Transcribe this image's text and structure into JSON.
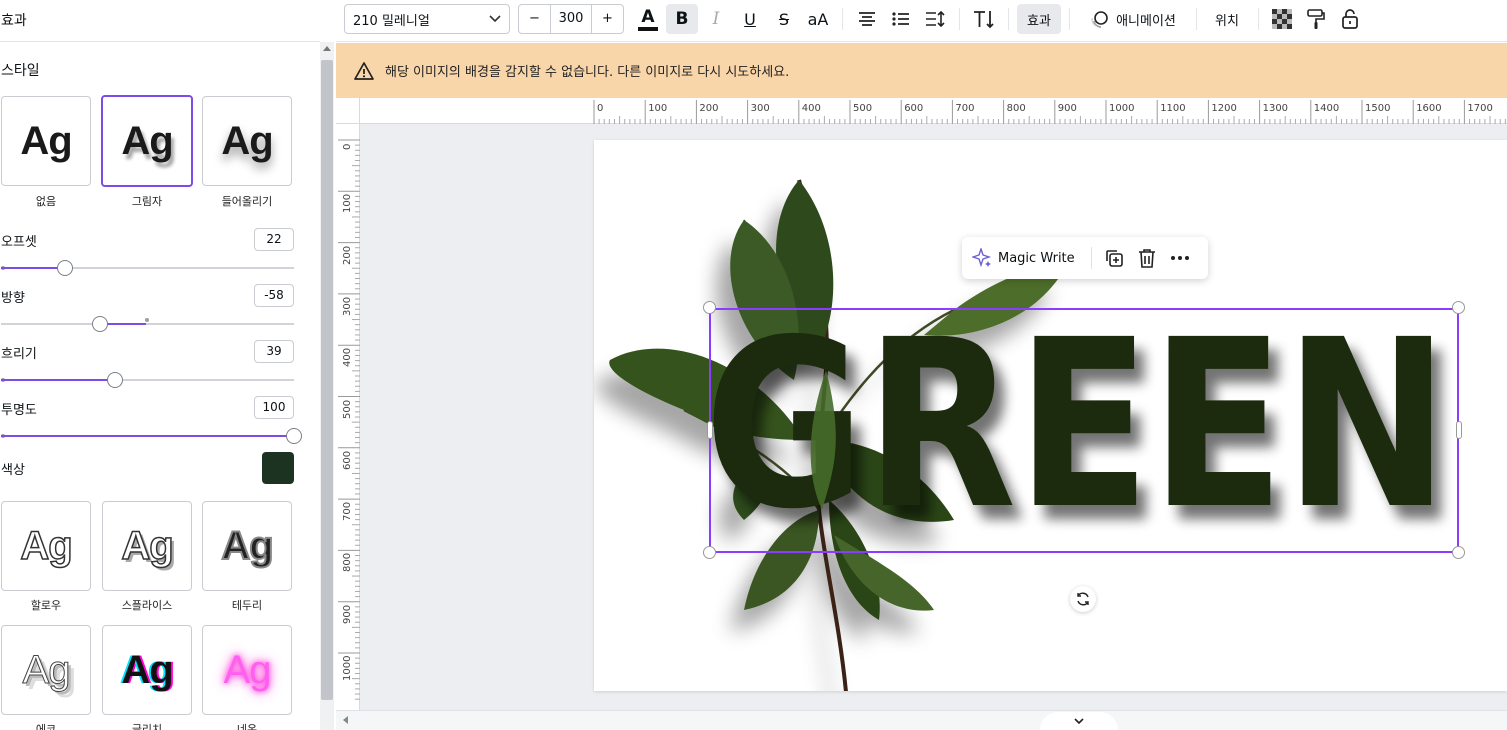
{
  "panel": {
    "title": "효과",
    "style_section": "스타일",
    "style_tiles": [
      {
        "label": "없음",
        "sample": "Ag"
      },
      {
        "label": "그림자",
        "sample": "Ag"
      },
      {
        "label": "들어올리기",
        "sample": "Ag"
      }
    ],
    "controls": [
      {
        "label": "오프셋",
        "value": "22"
      },
      {
        "label": "방향",
        "value": "-58"
      },
      {
        "label": "흐리기",
        "value": "39"
      },
      {
        "label": "투명도",
        "value": "100"
      }
    ],
    "color_label": "색상",
    "shadow_color": "#1b3320",
    "effect_tiles": [
      {
        "label": "할로우",
        "sample": "Ag"
      },
      {
        "label": "스플라이스",
        "sample": "Ag"
      },
      {
        "label": "테두리",
        "sample": "Ag"
      },
      {
        "label": "에코",
        "sample": "Ag"
      },
      {
        "label": "글리치",
        "sample": "Ag"
      },
      {
        "label": "네온",
        "sample": "Ag"
      }
    ]
  },
  "toolbar": {
    "font_name": "210 밀레니얼",
    "font_size": "300",
    "minus": "−",
    "plus": "+",
    "text_color_label": "A",
    "bold": "B",
    "italic": "I",
    "underline": "U",
    "strike": "S",
    "case": "aA",
    "effects": "효과",
    "animate": "애니메이션",
    "position": "위치",
    "accent": "#7d4be8"
  },
  "warning": {
    "text": "해당 이미지의 배경을 감지할 수 없습니다. 다른 이미지로 다시 시도하세요."
  },
  "ruler": {
    "top": [
      "0",
      "100",
      "200",
      "300",
      "400",
      "500",
      "600",
      "700",
      "800",
      "900",
      "1000",
      "1100",
      "1200",
      "1300",
      "1400",
      "1500",
      "1600",
      "1700"
    ],
    "left": [
      "0",
      "100",
      "200",
      "300",
      "400",
      "500",
      "600",
      "700",
      "800",
      "900",
      "1000"
    ]
  },
  "canvas": {
    "text": "GREEN",
    "text_color": "#1a2a0e"
  },
  "floating_toolbar": {
    "magic_write": "Magic Write"
  }
}
